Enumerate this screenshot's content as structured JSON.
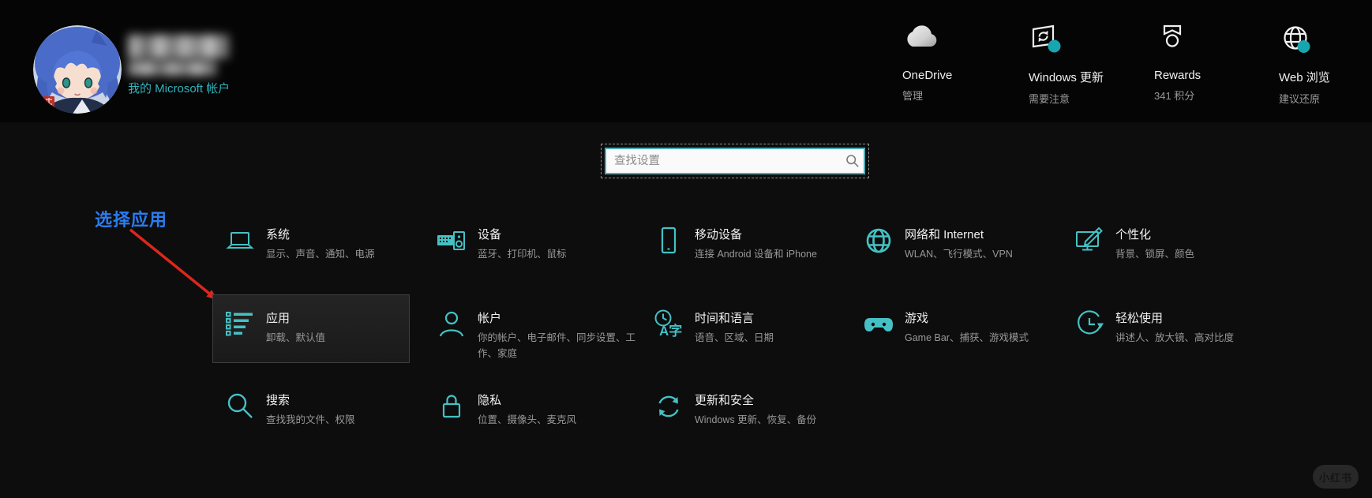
{
  "colors": {
    "accent_teal": "#45c1c5",
    "badge_teal": "#17a5b0",
    "link_teal": "#2eb5be",
    "annotation_blue": "#2b7cf0",
    "arrow_red": "#dc271d",
    "search_border": "#46aeb5"
  },
  "header": {
    "account_link": "我的 Microsoft 帐户",
    "avatar": {
      "icon": "user-avatar-anime",
      "name_redacted": true
    },
    "quick_status": [
      {
        "title": "OneDrive",
        "subtitle": "管理",
        "icon": "onedrive-cloud-icon",
        "badge": false
      },
      {
        "title": "Windows 更新",
        "subtitle": "需要注意",
        "icon": "windows-update-icon",
        "badge": true
      },
      {
        "title": "Rewards",
        "subtitle": "341 积分",
        "icon": "rewards-medal-icon",
        "badge": false
      },
      {
        "title": "Web 浏览",
        "subtitle": "建议还原",
        "icon": "web-globe-icon",
        "badge": true
      }
    ]
  },
  "search": {
    "placeholder": "查找设置",
    "icon": "search-icon"
  },
  "annotation": {
    "label": "选择应用",
    "arrow": "red-arrow-to-apps-tile"
  },
  "tiles": [
    {
      "title": "系统",
      "subtitle": "显示、声音、通知、电源",
      "icon": "system-laptop-icon"
    },
    {
      "title": "设备",
      "subtitle": "蓝牙、打印机、鼠标",
      "icon": "devices-icon"
    },
    {
      "title": "移动设备",
      "subtitle": "连接 Android 设备和 iPhone",
      "icon": "phone-icon"
    },
    {
      "title": "网络和 Internet",
      "subtitle": "WLAN、飞行模式、VPN",
      "icon": "network-globe-icon"
    },
    {
      "title": "个性化",
      "subtitle": "背景、锁屏、颜色",
      "icon": "personalization-icon"
    },
    {
      "title": "应用",
      "subtitle": "卸载、默认值",
      "icon": "apps-list-icon",
      "highlighted": true
    },
    {
      "title": "帐户",
      "subtitle": "你的帐户、电子邮件、同步设置、工作、家庭",
      "icon": "accounts-person-icon"
    },
    {
      "title": "时间和语言",
      "subtitle": "语音、区域、日期",
      "icon": "time-language-icon"
    },
    {
      "title": "游戏",
      "subtitle": "Game Bar、捕获、游戏模式",
      "icon": "gaming-controller-icon"
    },
    {
      "title": "轻松使用",
      "subtitle": "讲述人、放大镜、高对比度",
      "icon": "ease-of-access-icon"
    },
    {
      "title": "搜索",
      "subtitle": "查找我的文件、权限",
      "icon": "search-magnifier-icon"
    },
    {
      "title": "隐私",
      "subtitle": "位置、摄像头、麦克风",
      "icon": "privacy-lock-icon"
    },
    {
      "title": "更新和安全",
      "subtitle": "Windows 更新、恢复、备份",
      "icon": "update-security-sync-icon"
    }
  ],
  "watermark": {
    "label": "小红书"
  }
}
